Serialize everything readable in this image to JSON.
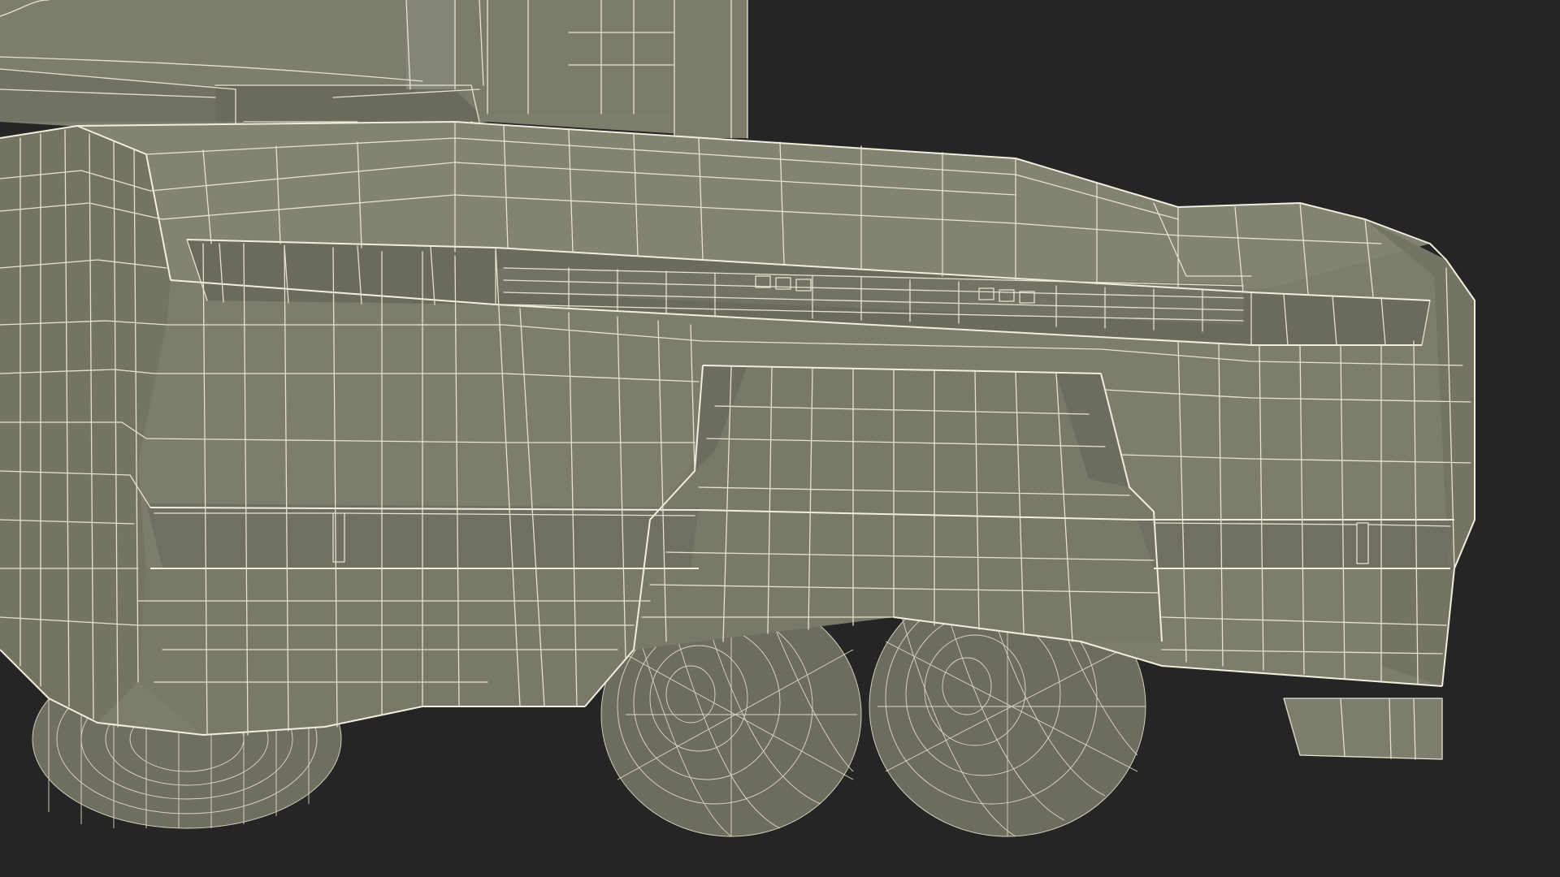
{
  "scene": {
    "subject": "truck-rear-bumper-wireframe",
    "colors": {
      "background": "#252525",
      "surface": "#7c7d6c",
      "surface_dark": "#6a6b5c",
      "surface_light": "#8a8b79",
      "shadow": "#4c4d43",
      "wire": "#e6e2cf"
    }
  }
}
